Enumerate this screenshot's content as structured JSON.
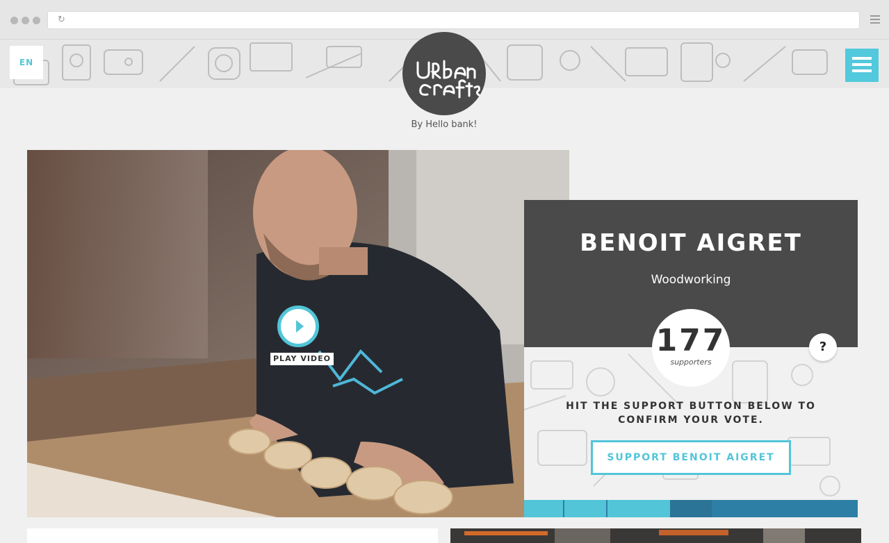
{
  "browser": {
    "url": ""
  },
  "header": {
    "language": "EN",
    "logo_text": "Urban Crafts",
    "byline": "By Hello bank!"
  },
  "hero": {
    "play_label": "PLAY VIDEO"
  },
  "candidate": {
    "name": "BENOIT AIGRET",
    "craft": "Woodworking",
    "supporter_count": "177",
    "supporter_label": "supporters",
    "help": "?",
    "instruction": "HIT THE SUPPORT BUTTON BELOW TO CONFIRM YOUR VOTE.",
    "support_button": "SUPPORT BENOIT AIGRET",
    "progress_fraction": 0.5
  },
  "colors": {
    "accent": "#52c5d8",
    "dark": "#4a4a4a",
    "progress_dark": "#2e7fa6"
  }
}
